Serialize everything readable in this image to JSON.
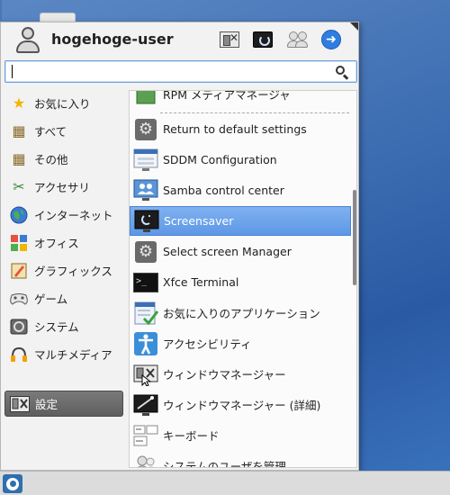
{
  "user": {
    "name": "hogehoge-user"
  },
  "header_buttons": [
    {
      "icon": "settings-manager-icon"
    },
    {
      "icon": "lock-screen-icon"
    },
    {
      "icon": "switch-users-icon"
    },
    {
      "icon": "logout-icon"
    }
  ],
  "search": {
    "value": "",
    "placeholder": ""
  },
  "categories": [
    {
      "label": "お気に入り",
      "icon": "star-icon",
      "active": false
    },
    {
      "label": "すべて",
      "icon": "all-apps-icon",
      "active": false
    },
    {
      "label": "その他",
      "icon": "other-icon",
      "active": false
    },
    {
      "label": "アクセサリ",
      "icon": "accessories-icon",
      "active": false
    },
    {
      "label": "インターネット",
      "icon": "globe-icon",
      "active": false
    },
    {
      "label": "オフィス",
      "icon": "office-icon",
      "active": false
    },
    {
      "label": "グラフィックス",
      "icon": "graphics-icon",
      "active": false
    },
    {
      "label": "ゲーム",
      "icon": "gamepad-icon",
      "active": false
    },
    {
      "label": "システム",
      "icon": "system-icon",
      "active": false
    },
    {
      "label": "マルチメディア",
      "icon": "headphones-icon",
      "active": false
    },
    {
      "label": "設定",
      "icon": "settings-icon",
      "active": true
    }
  ],
  "apps": [
    {
      "label": "RPM メディアマネージャ",
      "icon": "rpm-icon",
      "selected": false
    },
    {
      "label": "Return to default settings",
      "icon": "gear-icon",
      "selected": false
    },
    {
      "label": "SDDM Configuration",
      "icon": "login-screen-icon",
      "selected": false
    },
    {
      "label": "Samba control center",
      "icon": "network-monitor-icon",
      "selected": false
    },
    {
      "label": "Screensaver",
      "icon": "screensaver-icon",
      "selected": true
    },
    {
      "label": "Select screen Manager",
      "icon": "gear-icon",
      "selected": false
    },
    {
      "label": "Xfce Terminal",
      "icon": "terminal-icon",
      "selected": false
    },
    {
      "label": "お気に入りのアプリケーション",
      "icon": "checklist-icon",
      "selected": false
    },
    {
      "label": "アクセシビリティ",
      "icon": "accessibility-icon",
      "selected": false
    },
    {
      "label": "ウィンドウマネージャー",
      "icon": "window-manager-icon",
      "selected": false
    },
    {
      "label": "ウィンドウマネージャー (詳細)",
      "icon": "window-manager-tweaks-icon",
      "selected": false
    },
    {
      "label": "キーボード",
      "icon": "keyboard-icon",
      "selected": false
    },
    {
      "label": "システムのユーザを管理",
      "icon": "users-icon",
      "selected": false
    }
  ],
  "colors": {
    "selection": "#5d98e6",
    "active_category": "#666666",
    "desktop": "#3f6fb3"
  }
}
